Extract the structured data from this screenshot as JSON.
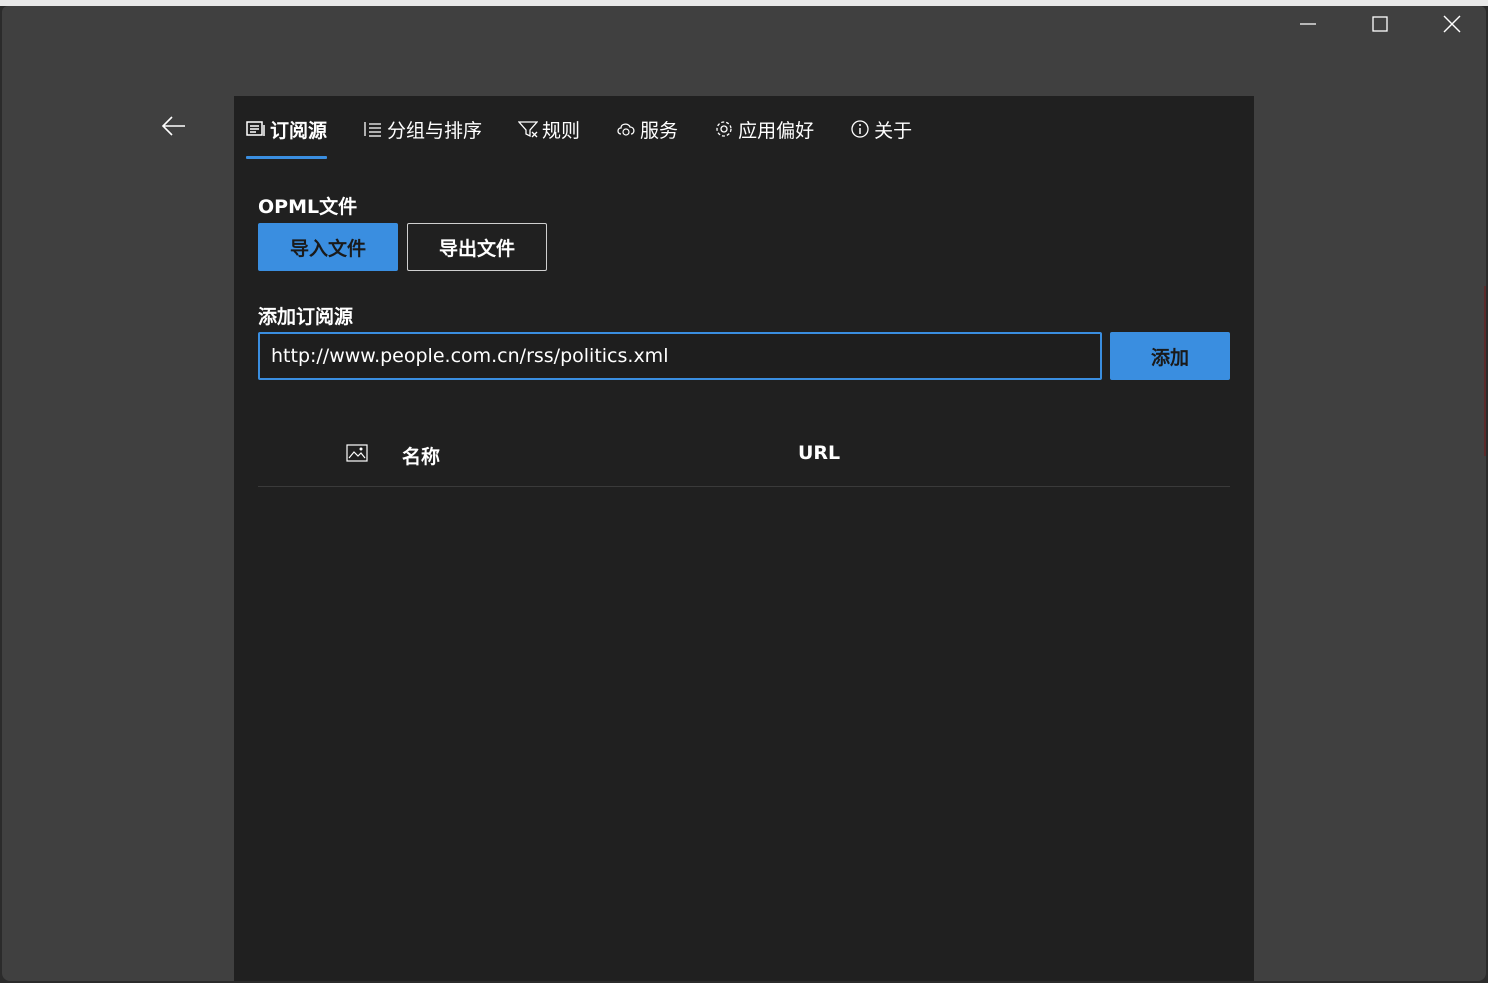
{
  "window": {
    "minimize_icon": "minimize-icon",
    "maximize_icon": "maximize-icon",
    "close_icon": "close-icon"
  },
  "nav": {
    "back_icon": "arrow-left-icon"
  },
  "tabs": [
    {
      "label": "订阅源",
      "icon": "feed-icon",
      "active": true
    },
    {
      "label": "分组与排序",
      "icon": "list-icon",
      "active": false
    },
    {
      "label": "规则",
      "icon": "filter-icon",
      "active": false
    },
    {
      "label": "服务",
      "icon": "cloud-sync-icon",
      "active": false
    },
    {
      "label": "应用偏好",
      "icon": "gear-icon",
      "active": false
    },
    {
      "label": "关于",
      "icon": "info-icon",
      "active": false
    }
  ],
  "opml": {
    "label": "OPML文件",
    "import_label": "导入文件",
    "export_label": "导出文件"
  },
  "add_source": {
    "label": "添加订阅源",
    "url_value": "http://www.people.com.cn/rss/politics.xml",
    "add_label": "添加"
  },
  "table": {
    "icon_column_icon": "image-icon",
    "columns": [
      "名称",
      "URL"
    ],
    "rows": []
  },
  "colors": {
    "accent": "#3a8ee0",
    "panel_bg": "#202020",
    "window_bg": "#404040"
  }
}
